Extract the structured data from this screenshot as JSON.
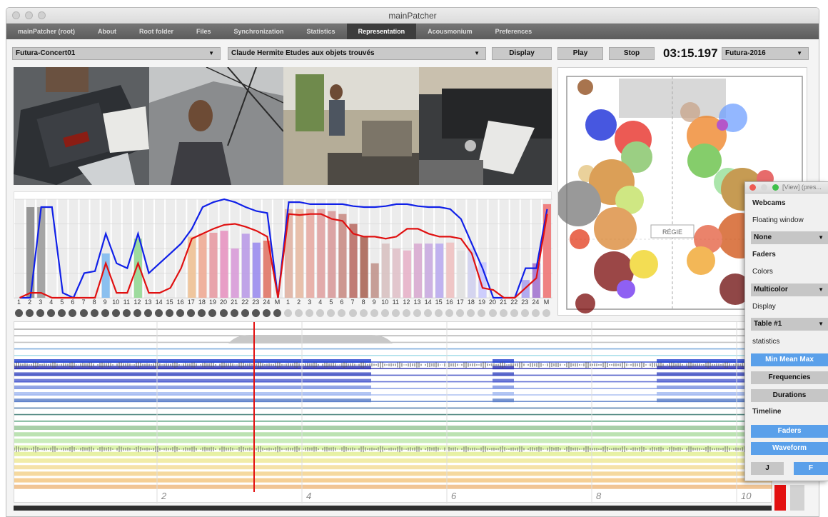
{
  "window": {
    "title": "mainPatcher"
  },
  "tabs": [
    "mainPatcher (root)",
    "About",
    "Root folder",
    "Files",
    "Synchronization",
    "Statistics",
    "Representation",
    "Acousmonium",
    "Preferences"
  ],
  "active_tab": "Representation",
  "toolbar": {
    "concert": "Futura-Concert01",
    "piece": "Claude Hermite Etudes aux objets trouvés",
    "display": "Display",
    "play": "Play",
    "stop": "Stop",
    "timecode": "03:15.197",
    "edition": "Futura-2016"
  },
  "chart": {
    "x_labels": [
      "1",
      "2",
      "3",
      "4",
      "5",
      "6",
      "7",
      "8",
      "9",
      "10",
      "11",
      "12",
      "13",
      "14",
      "15",
      "16",
      "17",
      "18",
      "19",
      "20",
      "21",
      "22",
      "23",
      "24",
      "M",
      "1",
      "2",
      "3",
      "4",
      "5",
      "6",
      "7",
      "8",
      "9",
      "10",
      "11",
      "12",
      "13",
      "14",
      "15",
      "16",
      "17",
      "18",
      "19",
      "20",
      "21",
      "22",
      "23",
      "24",
      "M"
    ],
    "bars": [
      0,
      0.92,
      0.92,
      0,
      0,
      0,
      0,
      0,
      0.45,
      0,
      0,
      0.6,
      0,
      0,
      0,
      0,
      0.62,
      0.65,
      0.66,
      0.68,
      0.5,
      0.65,
      0.56,
      0.58,
      0,
      0.9,
      0.9,
      0.9,
      0.9,
      0.88,
      0.85,
      0.75,
      0.62,
      0.35,
      0.55,
      0.5,
      0.48,
      0.55,
      0.55,
      0.55,
      0.56,
      0.48,
      0.5,
      0.36,
      0,
      0,
      0,
      0.18,
      0.35,
      0.95
    ],
    "blue_line": [
      0,
      0,
      0.92,
      0.92,
      0.05,
      0,
      0.25,
      0.27,
      0.65,
      0.35,
      0.3,
      0.65,
      0.25,
      0.35,
      0.45,
      0.55,
      0.7,
      0.92,
      0.97,
      1,
      0.97,
      0.92,
      0.88,
      0.86,
      0,
      0.97,
      0.97,
      0.95,
      0.95,
      0.95,
      0.95,
      0.93,
      0.92,
      0.92,
      0.93,
      0.95,
      0.95,
      0.93,
      0.92,
      0.92,
      0.9,
      0.8,
      0.55,
      0.3,
      0,
      0,
      0,
      0.3,
      0.3,
      0.9
    ],
    "red_line": [
      0,
      0.05,
      0.05,
      0,
      0,
      0,
      0,
      0,
      0.35,
      0.05,
      0.05,
      0.35,
      0.05,
      0.05,
      0.1,
      0.3,
      0.6,
      0.65,
      0.7,
      0.74,
      0.75,
      0.72,
      0.68,
      0.62,
      0,
      0.85,
      0.84,
      0.85,
      0.85,
      0.8,
      0.78,
      0.65,
      0.62,
      0.62,
      0.6,
      0.62,
      0.7,
      0.7,
      0.65,
      0.62,
      0.62,
      0.6,
      0.45,
      0.1,
      0.08,
      0,
      0,
      0.1,
      0.2,
      0.85
    ],
    "dots_dark": 25,
    "dots_light": 25
  },
  "timeline": {
    "axis_ticks": [
      "2",
      "4",
      "6",
      "8",
      "10"
    ]
  },
  "stage": {
    "label": "RÉGIE"
  },
  "panel": {
    "title": "[View] (pres...",
    "webcams": "Webcams",
    "floating_window": "Floating window",
    "floating_value": "None",
    "faders": "Faders",
    "colors": "Colors",
    "colors_value": "Multicolor",
    "display": "Display",
    "display_value": "Table #1",
    "statistics": "statistics",
    "min_mean_max": "Min Mean Max",
    "frequencies": "Frequencies",
    "durations": "Durations",
    "timeline": "Timeline",
    "faders_btn": "Faders",
    "waveform_btn": "Waveform",
    "j_btn": "J",
    "f_btn": "F"
  },
  "colors": {
    "accent_blue": "#5aa0ea",
    "playhead": "#e31010",
    "tab_bar": "#5c5c5c"
  }
}
